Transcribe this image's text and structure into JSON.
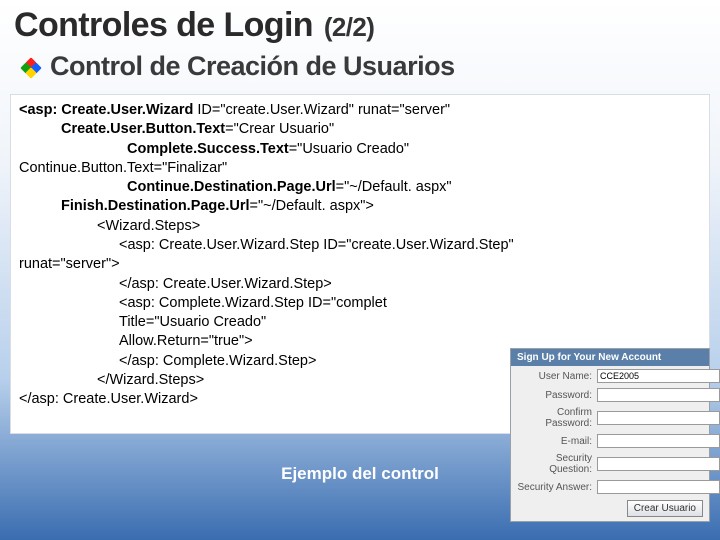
{
  "title": "Controles de Login",
  "title_fraction": "(2/2)",
  "subtitle": "Control de Creación de Usuarios",
  "caption": "Ejemplo del control",
  "code": {
    "line1_tag": "<asp: Create.User.Wizard",
    "line1_rest": " ID=\"create.User.Wizard\" runat=\"server\"",
    "line2_key": "Create.User.Button.Text",
    "line2_val": "=\"Crear Usuario\"",
    "line3_key": "Complete.Success.Text",
    "line3_val": "=\"Usuario Creado\"",
    "line4": "Continue.Button.Text=\"Finalizar\"",
    "line5_key": "Continue.Destination.Page.Url",
    "line5_val": "=\"~/Default. aspx\"",
    "line6_key": "Finish.Destination.Page.Url",
    "line6_val": "=\"~/Default. aspx\">",
    "line7": "<Wizard.Steps>",
    "line8": "<asp: Create.User.Wizard.Step ID=\"create.User.Wizard.Step\"",
    "line9": "runat=\"server\">",
    "line10": "</asp: Create.User.Wizard.Step>",
    "line11": "<asp: Complete.Wizard.Step ID=\"complet",
    "line12": "Title=\"Usuario Creado\"",
    "line13": "Allow.Return=\"true\">",
    "line14": "</asp: Complete.Wizard.Step>",
    "line15": "</Wizard.Steps>",
    "line16": "</asp: Create.User.Wizard>"
  },
  "form": {
    "header": "Sign Up for Your New Account",
    "rows": [
      {
        "label": "User Name:",
        "value": "CCE2005"
      },
      {
        "label": "Password:",
        "value": ""
      },
      {
        "label": "Confirm Password:",
        "value": ""
      },
      {
        "label": "E-mail:",
        "value": ""
      },
      {
        "label": "Security Question:",
        "value": ""
      },
      {
        "label": "Security Answer:",
        "value": ""
      }
    ],
    "button": "Crear Usuario"
  }
}
